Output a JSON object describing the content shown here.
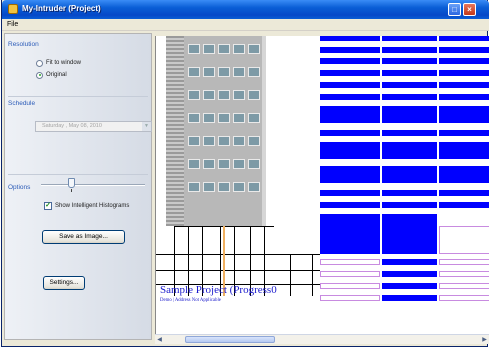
{
  "window": {
    "title": "My-Intruder (Project)"
  },
  "menu": {
    "file": "File"
  },
  "sidebar": {
    "resolution_title": "Resolution",
    "fit_to_window": "Fit to window",
    "original": "Original",
    "schedule_title": "Schedule",
    "date_text": "Saturday  ,   May     08, 2010",
    "options_title": "Options",
    "show_histograms": "Show Intelligent Histograms",
    "save_as_image": "Save as Image...",
    "settings": "Settings..."
  },
  "canvas": {
    "project_title": "Sample Project (Progress0",
    "project_subtitle": "Demo | Address Not Applicable"
  },
  "colors": {
    "titlebar": "#0a5ed6",
    "accent_blue": "#0000ff",
    "label_blue": "#2c5cb8"
  }
}
